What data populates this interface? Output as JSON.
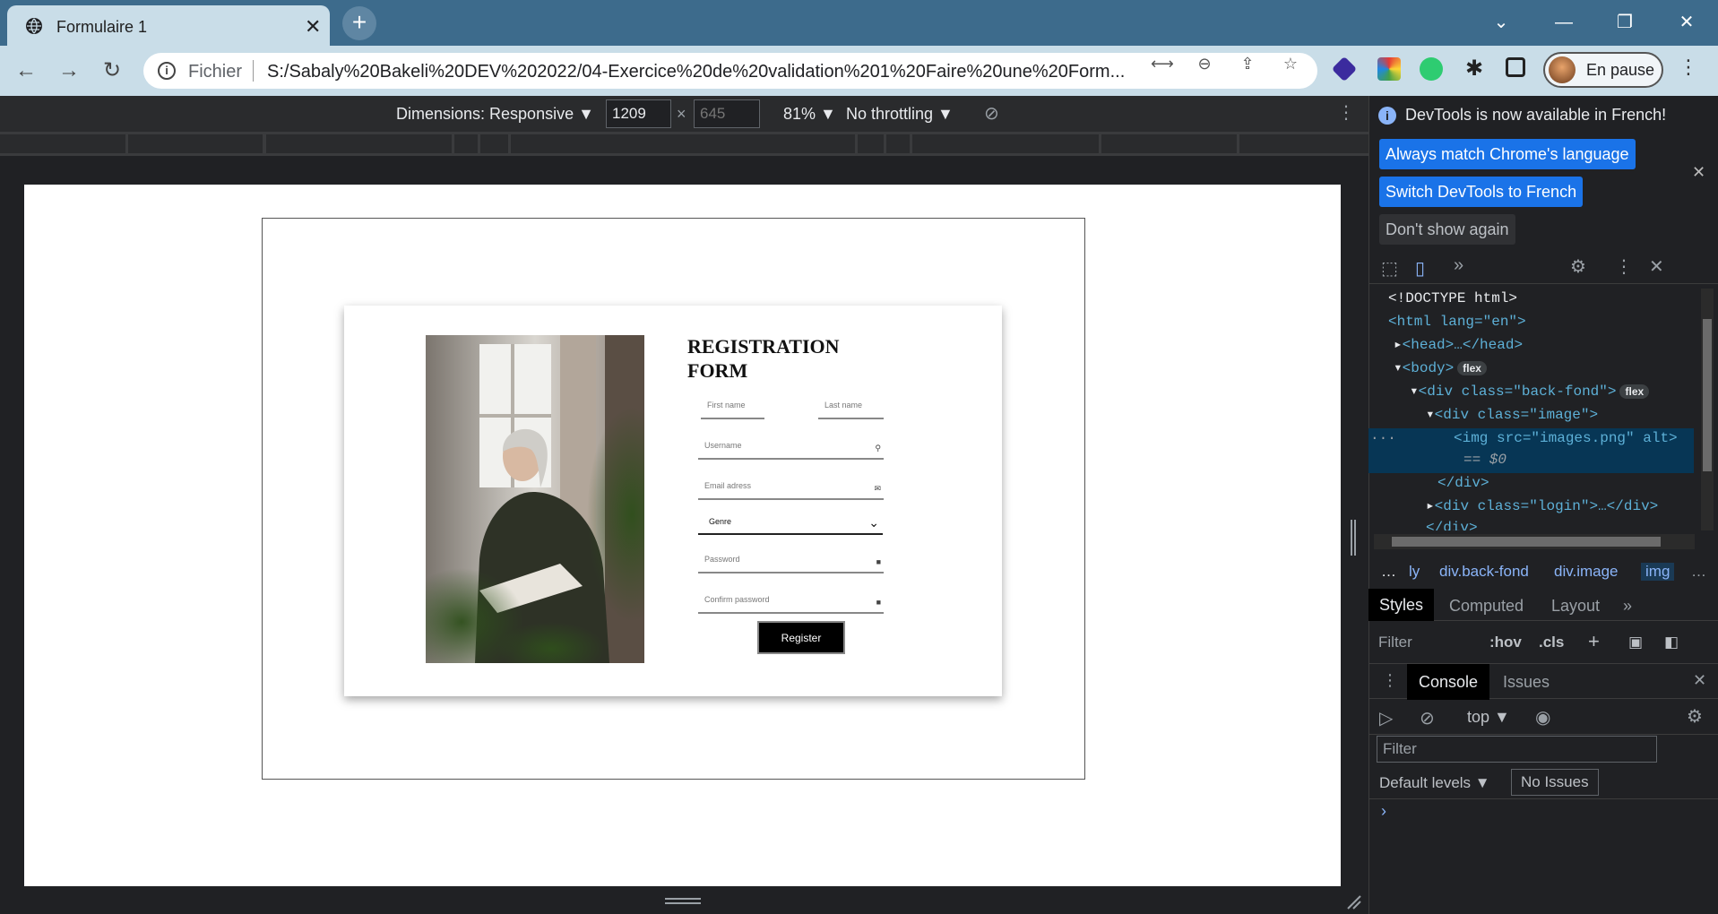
{
  "browser": {
    "tab_title": "Formulaire 1",
    "tab_close": "✕",
    "new_tab": "+",
    "url_scheme": "Fichier",
    "url": "S:/Sabaly%20Bakeli%20DEV%202022/04-Exercice%20de%20validation%201%20Faire%20une%20Form...",
    "profile_status": "En pause",
    "window_controls": [
      "chevron-down-icon",
      "minimize-icon",
      "restore-icon",
      "close-icon"
    ]
  },
  "device_toolbar": {
    "dimensions_label": "Dimensions: Responsive ▼",
    "width": "1209",
    "height_placeholder": "645",
    "times": "×",
    "zoom": "81% ▼",
    "throttling": "No throttling ▼"
  },
  "page": {
    "form_title": "REGISTRATION FORM",
    "fields": {
      "first_name": "First name",
      "last_name": "Last name",
      "username": "Username",
      "email": "Email adress",
      "password": "Password",
      "confirm_password": "Confirm password"
    },
    "genre_select": "Genre",
    "register_label": "Register"
  },
  "devtools": {
    "banner_text": "DevTools is now available in French!",
    "always_match": "Always match Chrome's language",
    "switch_french": "Switch DevTools to French",
    "dont_show": "Don't show again",
    "elements": {
      "doctype": "<!DOCTYPE html>",
      "html_open": "<html lang=\"en\">",
      "head": "<head>…</head>",
      "body": "<body>",
      "div_back_fond": "<div class=\"back-fond\">",
      "div_image": "<div class=\"image\">",
      "img_line": "<img src=\"images.png\" alt>",
      "img_src": "images.png",
      "img_eq": "== $0",
      "div_close": "</div>",
      "div_login": "<div class=\"login\">…</div>",
      "div_close_cut": "</div>",
      "flex_badge": "flex"
    },
    "breadcrumbs": [
      "…",
      "ly",
      "div.back-fond",
      "div.image",
      "img",
      "…"
    ],
    "style_tabs": [
      "Styles",
      "Computed",
      "Layout",
      "»"
    ],
    "filter_placeholder": "Filter",
    "hov": ":hov",
    "cls": ".cls",
    "drawer_tabs": [
      "Console",
      "Issues"
    ],
    "context": "top ▼",
    "console_filter": "Filter",
    "default_levels": "Default levels ▼",
    "no_issues": "No Issues",
    "prompt": "›"
  },
  "colors": {
    "titlebar": "#3d6b8c",
    "toolbar": "#c9dde8",
    "devtools_bg": "#202124",
    "accent_blue": "#1a73e8"
  }
}
